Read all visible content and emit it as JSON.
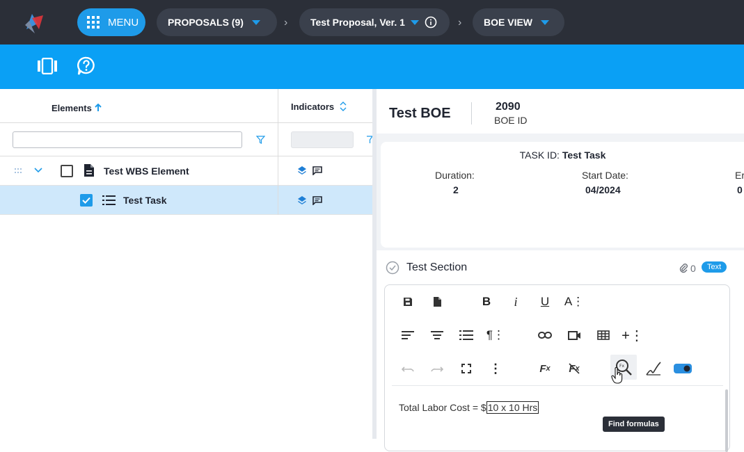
{
  "nav": {
    "menu_label": "MENU",
    "proposals_label": "PROPOSALS (9)",
    "proposal_label": "Test Proposal, Ver. 1",
    "view_label": "BOE VIEW"
  },
  "grid": {
    "col_elements": "Elements",
    "col_indicators": "Indicators",
    "search_value": "",
    "rows": [
      {
        "label": "Test WBS Element",
        "checked": false,
        "selected": false
      },
      {
        "label": "Test Task",
        "checked": true,
        "selected": true
      }
    ]
  },
  "boe": {
    "title": "Test BOE",
    "id_value": "2090",
    "id_label": "BOE ID"
  },
  "task": {
    "prefix": "TASK ID:",
    "name": "Test Task",
    "duration_label": "Duration:",
    "duration_value": "2",
    "start_label": "Start Date:",
    "start_value": "04/2024",
    "end_label": "Er",
    "end_value": "0"
  },
  "section": {
    "title": "Test Section",
    "attach_count": "0",
    "badge": "Text"
  },
  "editor": {
    "tooltip": "Find formulas",
    "content_prefix": "Total Labor Cost = $",
    "content_formula": "10 x 10 Hrs"
  },
  "colors": {
    "topbar": "#2b2f38",
    "accent": "#1e9be9",
    "bluebar": "#0aa0f5",
    "selected_row": "#cfe8fb"
  }
}
